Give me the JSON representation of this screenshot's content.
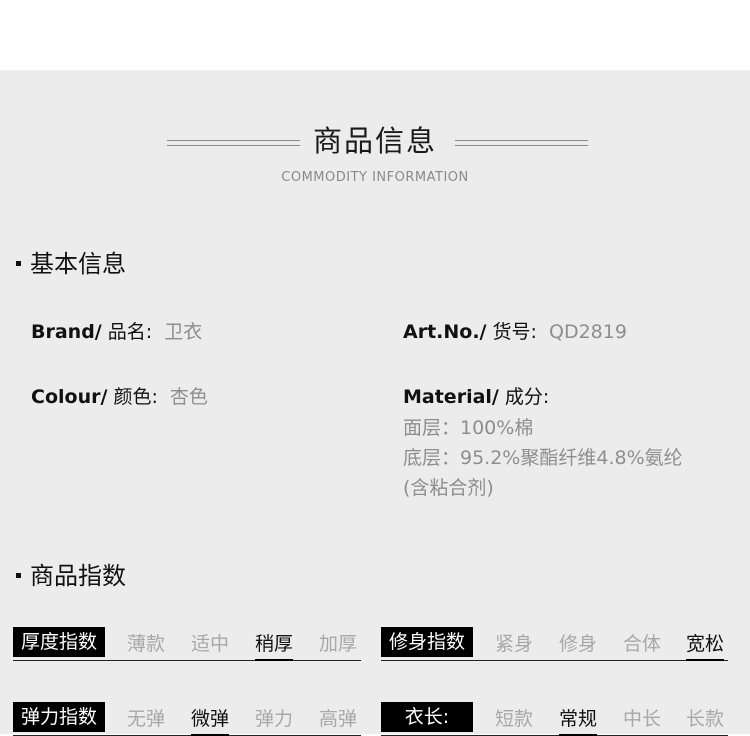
{
  "header": {
    "title": "商品信息",
    "subtitle": "COMMODITY INFORMATION"
  },
  "basic_info": {
    "heading": "基本信息",
    "brand": {
      "label_en": "Brand/",
      "label_cn": "品名:",
      "value": "卫衣"
    },
    "art_no": {
      "label_en": "Art.No./",
      "label_cn": "货号:",
      "value": "QD2819"
    },
    "colour": {
      "label_en": "Colour/",
      "label_cn": "颜色:",
      "value": "杏色"
    },
    "material": {
      "label_en": "Material/",
      "label_cn": "成分:",
      "lines": [
        "面层：100%棉",
        "底层：95.2%聚酯纤维4.8%氨纶",
        "(含粘合剂)"
      ]
    }
  },
  "indices": {
    "heading": "商品指数",
    "thickness": {
      "label": "厚度指数",
      "options": [
        "薄款",
        "适中",
        "稍厚",
        "加厚"
      ],
      "selected": "稍厚"
    },
    "fit": {
      "label": "修身指数",
      "options": [
        "紧身",
        "修身",
        "合体",
        "宽松"
      ],
      "selected": "宽松"
    },
    "elasticity": {
      "label": "弹力指数",
      "options": [
        "无弹",
        "微弹",
        "弹力",
        "高弹"
      ],
      "selected": "微弹"
    },
    "length": {
      "label": "衣长:",
      "options": [
        "短款",
        "常规",
        "中长",
        "长款"
      ],
      "selected": "常规"
    }
  }
}
